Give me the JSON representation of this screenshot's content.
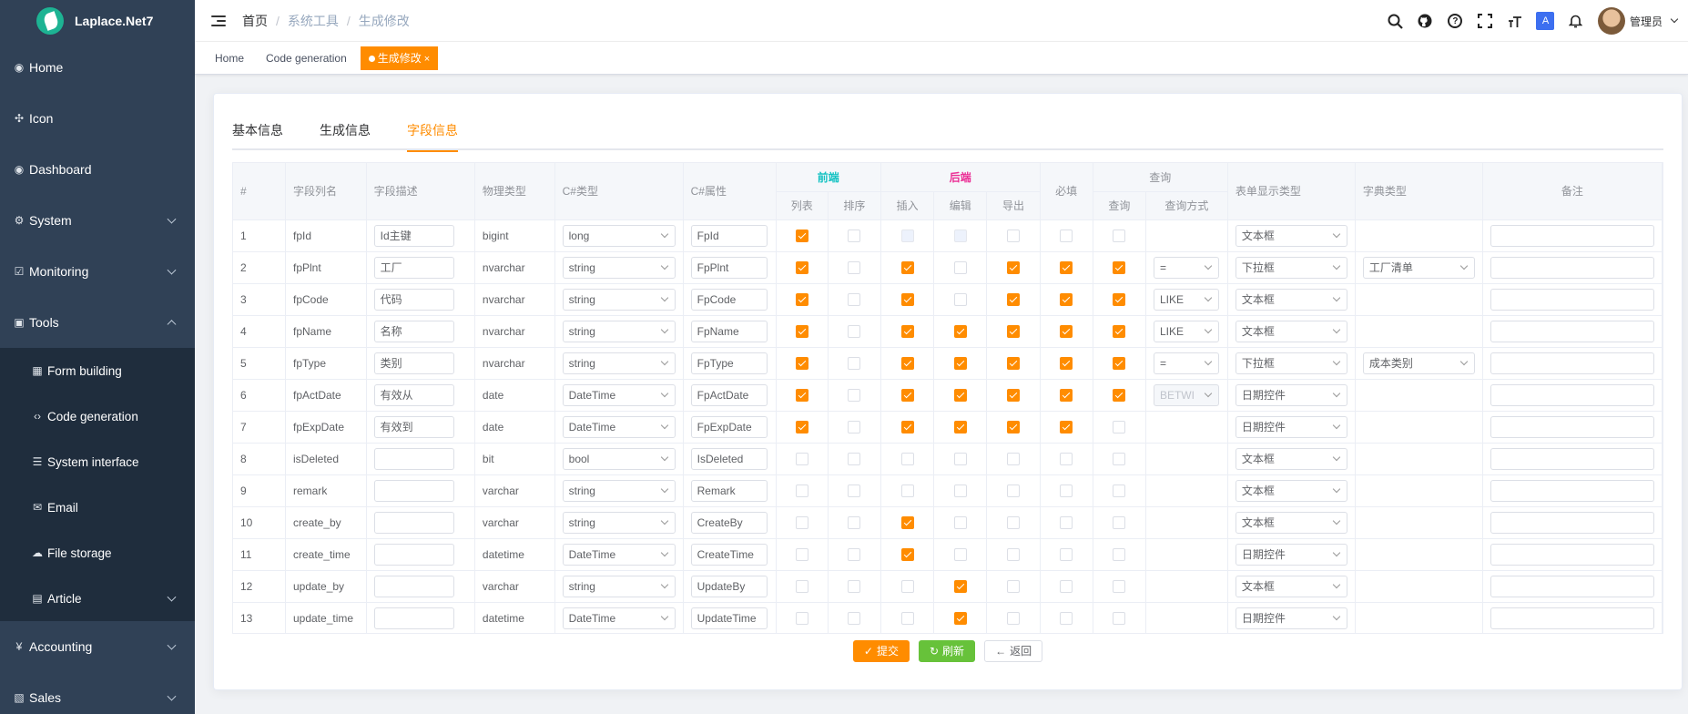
{
  "app": {
    "logo_text": "Laplace.Net7"
  },
  "sidebar": {
    "items": [
      {
        "icon": "◉",
        "label": "Home",
        "chevron": ""
      },
      {
        "icon": "✣",
        "label": "Icon",
        "chevron": ""
      },
      {
        "icon": "◉",
        "label": "Dashboard",
        "chevron": ""
      },
      {
        "icon": "⚙",
        "label": "System",
        "chevron": "down"
      },
      {
        "icon": "☑",
        "label": "Monitoring",
        "chevron": "down"
      },
      {
        "icon": "▣",
        "label": "Tools",
        "chevron": "up"
      },
      {
        "icon": "▦",
        "label": "Form building",
        "sub": true
      },
      {
        "icon": "‹›",
        "label": "Code generation",
        "sub": true
      },
      {
        "icon": "☰",
        "label": "System interface",
        "sub": true
      },
      {
        "icon": "✉",
        "label": "Email",
        "sub": true
      },
      {
        "icon": "☁",
        "label": "File storage",
        "sub": true
      },
      {
        "icon": "▤",
        "label": "Article",
        "sub": true,
        "chevron": "down"
      },
      {
        "icon": "¥",
        "label": "Accounting",
        "chevron": "down"
      },
      {
        "icon": "▧",
        "label": "Sales",
        "chevron": "down"
      }
    ]
  },
  "header": {
    "breadcrumb": [
      "首页",
      "系统工具",
      "生成修改"
    ],
    "username": "管理员"
  },
  "tags": [
    {
      "label": "Home",
      "active": false
    },
    {
      "label": "Code generation",
      "active": false
    },
    {
      "label": "生成修改",
      "active": true
    }
  ],
  "tabs": [
    {
      "label": "基本信息",
      "active": false
    },
    {
      "label": "生成信息",
      "active": false
    },
    {
      "label": "字段信息",
      "active": true
    }
  ],
  "table": {
    "headers": {
      "index": "#",
      "column_name": "字段列名",
      "description": "字段描述",
      "physical_type": "物理类型",
      "cs_type": "C#类型",
      "cs_field": "C#属性",
      "group_front": "前端",
      "list": "列表",
      "sort": "排序",
      "group_back": "后端",
      "insert": "插入",
      "edit": "编辑",
      "export": "导出",
      "required": "必填",
      "group_query": "查询",
      "query": "查询",
      "query_type": "查询方式",
      "html_type": "表单显示类型",
      "dict_type": "字典类型",
      "remark": "备注"
    },
    "rows": [
      {
        "idx": "1",
        "col": "fpId",
        "desc": "Id主键",
        "ptype": "bigint",
        "cstype": "long",
        "csfield": "FpId",
        "list": 1,
        "sort": 0,
        "insert": 0,
        "edit": 0,
        "export": 0,
        "required": 0,
        "query": 0,
        "qtype": "",
        "html": "文本框",
        "dict": "",
        "dis": {
          "insert": 1,
          "edit": 1
        }
      },
      {
        "idx": "2",
        "col": "fpPlnt",
        "desc": "工厂",
        "ptype": "nvarchar",
        "cstype": "string",
        "csfield": "FpPlnt",
        "list": 1,
        "sort": 0,
        "insert": 1,
        "edit": 0,
        "export": 1,
        "required": 1,
        "query": 1,
        "qtype": "=",
        "html": "下拉框",
        "dict": "工厂清单"
      },
      {
        "idx": "3",
        "col": "fpCode",
        "desc": "代码",
        "ptype": "nvarchar",
        "cstype": "string",
        "csfield": "FpCode",
        "list": 1,
        "sort": 0,
        "insert": 1,
        "edit": 0,
        "export": 1,
        "required": 1,
        "query": 1,
        "qtype": "LIKE",
        "html": "文本框",
        "dict": ""
      },
      {
        "idx": "4",
        "col": "fpName",
        "desc": "名称",
        "ptype": "nvarchar",
        "cstype": "string",
        "csfield": "FpName",
        "list": 1,
        "sort": 0,
        "insert": 1,
        "edit": 1,
        "export": 1,
        "required": 1,
        "query": 1,
        "qtype": "LIKE",
        "html": "文本框",
        "dict": ""
      },
      {
        "idx": "5",
        "col": "fpType",
        "desc": "类别",
        "ptype": "nvarchar",
        "cstype": "string",
        "csfield": "FpType",
        "list": 1,
        "sort": 0,
        "insert": 1,
        "edit": 1,
        "export": 1,
        "required": 1,
        "query": 1,
        "qtype": "=",
        "html": "下拉框",
        "dict": "成本类别"
      },
      {
        "idx": "6",
        "col": "fpActDate",
        "desc": "有效从",
        "ptype": "date",
        "cstype": "DateTime",
        "csfield": "FpActDate",
        "list": 1,
        "sort": 0,
        "insert": 1,
        "edit": 1,
        "export": 1,
        "required": 1,
        "query": 1,
        "qtype": "BETWI",
        "qdis": 1,
        "html": "日期控件",
        "dict": ""
      },
      {
        "idx": "7",
        "col": "fpExpDate",
        "desc": "有效到",
        "ptype": "date",
        "cstype": "DateTime",
        "csfield": "FpExpDate",
        "list": 1,
        "sort": 0,
        "insert": 1,
        "edit": 1,
        "export": 1,
        "required": 1,
        "query": 0,
        "qtype": "",
        "html": "日期控件",
        "dict": ""
      },
      {
        "idx": "8",
        "col": "isDeleted",
        "desc": "",
        "ptype": "bit",
        "cstype": "bool",
        "csfield": "IsDeleted",
        "list": 0,
        "sort": 0,
        "insert": 0,
        "edit": 0,
        "export": 0,
        "required": 0,
        "query": 0,
        "qtype": "",
        "html": "文本框",
        "dict": ""
      },
      {
        "idx": "9",
        "col": "remark",
        "desc": "",
        "ptype": "varchar",
        "cstype": "string",
        "csfield": "Remark",
        "list": 0,
        "sort": 0,
        "insert": 0,
        "edit": 0,
        "export": 0,
        "required": 0,
        "query": 0,
        "qtype": "",
        "html": "文本框",
        "dict": ""
      },
      {
        "idx": "10",
        "col": "create_by",
        "desc": "",
        "ptype": "varchar",
        "cstype": "string",
        "csfield": "CreateBy",
        "list": 0,
        "sort": 0,
        "insert": 1,
        "edit": 0,
        "export": 0,
        "required": 0,
        "query": 0,
        "qtype": "",
        "html": "文本框",
        "dict": ""
      },
      {
        "idx": "11",
        "col": "create_time",
        "desc": "",
        "ptype": "datetime",
        "cstype": "DateTime",
        "csfield": "CreateTime",
        "list": 0,
        "sort": 0,
        "insert": 1,
        "edit": 0,
        "export": 0,
        "required": 0,
        "query": 0,
        "qtype": "",
        "html": "日期控件",
        "dict": ""
      },
      {
        "idx": "12",
        "col": "update_by",
        "desc": "",
        "ptype": "varchar",
        "cstype": "string",
        "csfield": "UpdateBy",
        "list": 0,
        "sort": 0,
        "insert": 0,
        "edit": 1,
        "export": 0,
        "required": 0,
        "query": 0,
        "qtype": "",
        "html": "文本框",
        "dict": ""
      },
      {
        "idx": "13",
        "col": "update_time",
        "desc": "",
        "ptype": "datetime",
        "cstype": "DateTime",
        "csfield": "UpdateTime",
        "list": 0,
        "sort": 0,
        "insert": 0,
        "edit": 1,
        "export": 0,
        "required": 0,
        "query": 0,
        "qtype": "",
        "html": "日期控件",
        "dict": ""
      }
    ]
  },
  "buttons": {
    "submit": "提交",
    "refresh": "刷新",
    "back": "返回"
  },
  "colors": {
    "accent": "#ff8c00",
    "success": "#67c23a",
    "sidebar": "#304156",
    "front": "#13c2c2",
    "back": "#eb2f96"
  }
}
